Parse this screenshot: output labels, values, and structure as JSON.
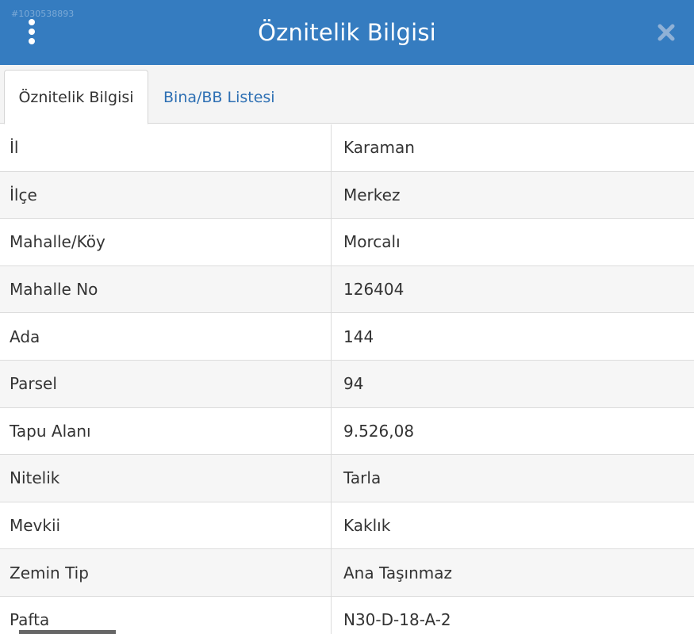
{
  "header": {
    "title": "Öznitelik Bilgisi",
    "watermark_id": "#1030538893",
    "background_color": "#357cc0"
  },
  "icons": {
    "menu": "vertical-dots-icon",
    "close": "close-x-icon"
  },
  "tabs": [
    {
      "label": "Öznitelik Bilgisi",
      "active": true
    },
    {
      "label": "Bina/BB Listesi",
      "active": false
    }
  ],
  "rows": [
    {
      "key": "İl",
      "value": "Karaman"
    },
    {
      "key": "İlçe",
      "value": "Merkez"
    },
    {
      "key": "Mahalle/Köy",
      "value": "Morcalı"
    },
    {
      "key": "Mahalle No",
      "value": "126404"
    },
    {
      "key": "Ada",
      "value": "144"
    },
    {
      "key": "Parsel",
      "value": "94"
    },
    {
      "key": "Tapu Alanı",
      "value": "9.526,08"
    },
    {
      "key": "Nitelik",
      "value": "Tarla"
    },
    {
      "key": "Mevkii",
      "value": "Kaklık"
    },
    {
      "key": "Zemin Tip",
      "value": "Ana Taşınmaz"
    },
    {
      "key": "Pafta",
      "value": "N30-D-18-A-2"
    }
  ]
}
